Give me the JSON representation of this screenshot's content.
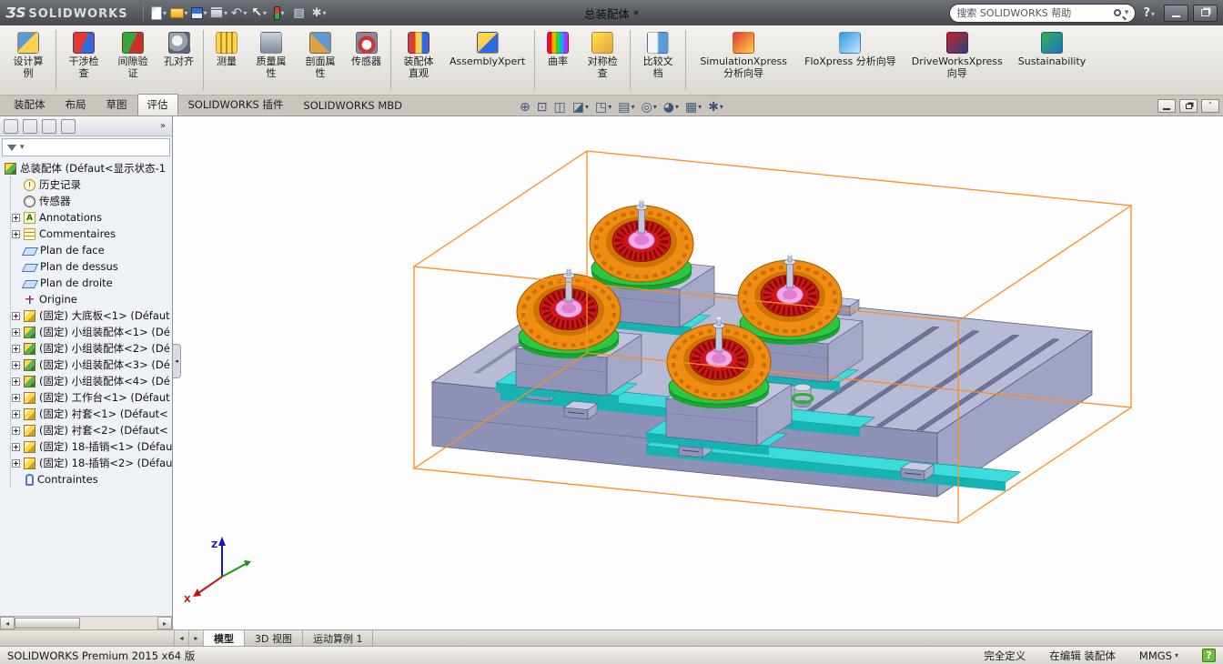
{
  "titlebar": {
    "logo_mark": "ƷS",
    "logo_text": "SOLIDWORKS",
    "doc_title": "总装配体 *",
    "search_placeholder": "搜索 SOLIDWORKS 帮助",
    "quick_icons": [
      {
        "name": "new-document-icon",
        "icon": "new-document",
        "dropdown": true
      },
      {
        "name": "open-icon",
        "icon": "open",
        "dropdown": true
      },
      {
        "name": "save-icon",
        "icon": "save",
        "dropdown": true
      },
      {
        "name": "print-icon",
        "icon": "print",
        "dropdown": true
      },
      {
        "name": "undo-icon",
        "icon": "undo",
        "dropdown": true
      },
      {
        "name": "select-icon",
        "icon": "select",
        "dropdown": true
      },
      {
        "name": "rebuild-icon",
        "icon": "rebuild",
        "dropdown": true
      },
      {
        "name": "file-properties-icon",
        "icon": "file-properties",
        "dropdown": false
      },
      {
        "name": "options-icon",
        "icon": "options",
        "dropdown": true
      }
    ]
  },
  "ribbon": {
    "items": [
      {
        "label": "设计算例",
        "icon": "design-study"
      },
      {
        "sep": true
      },
      {
        "label": "干涉检查",
        "icon": "interference-check"
      },
      {
        "label": "间隙验证",
        "icon": "clearance-verification"
      },
      {
        "label": "孔对齐",
        "icon": "hole-alignment"
      },
      {
        "sep": true
      },
      {
        "label": "测量",
        "icon": "measure"
      },
      {
        "label": "质量属性",
        "icon": "mass-properties"
      },
      {
        "label": "剖面属性",
        "icon": "section-properties"
      },
      {
        "label": "传感器",
        "icon": "sensor"
      },
      {
        "sep": true
      },
      {
        "label": "装配体直观",
        "icon": "assembly-visualization"
      },
      {
        "label": "AssemblyXpert",
        "icon": "assemblyxpert"
      },
      {
        "sep": true
      },
      {
        "label": "曲率",
        "icon": "curvature"
      },
      {
        "label": "对称检查",
        "icon": "symmetry-check"
      },
      {
        "sep": true
      },
      {
        "label": "比较文档",
        "icon": "compare-documents"
      },
      {
        "sep": true
      },
      {
        "label": "SimulationXpress 分析向导",
        "icon": "simulationxpress"
      },
      {
        "label": "FloXpress 分析向导",
        "icon": "floxpress"
      },
      {
        "label": "DriveWorksXpress 向导",
        "icon": "driveworksxpress"
      },
      {
        "label": "Sustainability",
        "icon": "sustainability"
      }
    ]
  },
  "command_tabs": [
    {
      "label": "装配体"
    },
    {
      "label": "布局"
    },
    {
      "label": "草图"
    },
    {
      "label": "评估",
      "active": true
    },
    {
      "label": "SOLIDWORKS 插件"
    },
    {
      "label": "SOLIDWORKS MBD"
    }
  ],
  "heads_up": [
    {
      "name": "zoom-fit-icon",
      "glyph": "⊕"
    },
    {
      "name": "zoom-area-icon",
      "glyph": "⊡"
    },
    {
      "name": "previous-view-icon",
      "glyph": "◫"
    },
    {
      "name": "section-view-icon",
      "glyph": "◪",
      "dropdown": true
    },
    {
      "name": "view-orientation-icon",
      "glyph": "◳",
      "dropdown": true
    },
    {
      "name": "display-style-icon",
      "glyph": "▤",
      "dropdown": true
    },
    {
      "name": "hide-show-icon",
      "glyph": "◎",
      "dropdown": true
    },
    {
      "name": "edit-appearance-icon",
      "glyph": "◕",
      "dropdown": true
    },
    {
      "name": "apply-scene-icon",
      "glyph": "▦",
      "dropdown": true
    },
    {
      "name": "view-settings-icon",
      "glyph": "✱",
      "dropdown": true
    }
  ],
  "manager_tabs": [
    {
      "name": "featuremanager-tab",
      "icon": "mt-feature"
    },
    {
      "name": "propertymanager-tab",
      "icon": "mt-property"
    },
    {
      "name": "configurationmanager-tab",
      "icon": "mt-config"
    },
    {
      "name": "displaymanager-tab",
      "icon": "mt-display"
    }
  ],
  "tree": {
    "more_glyph": "»",
    "root": "总装配体 (Défaut<显示状态-1",
    "items": [
      {
        "label": "历史记录",
        "icon": "history"
      },
      {
        "label": "传感器",
        "icon": "sensors"
      },
      {
        "label": "Annotations",
        "icon": "annotations",
        "expand": true
      },
      {
        "label": "Commentaires",
        "icon": "comments",
        "expand": true
      },
      {
        "label": "Plan de face",
        "icon": "plane"
      },
      {
        "label": "Plan de dessus",
        "icon": "plane"
      },
      {
        "label": "Plan de droite",
        "icon": "plane"
      },
      {
        "label": "Origine",
        "icon": "origin"
      },
      {
        "label": "(固定) 大底板<1> (Défaut",
        "icon": "part",
        "expand": true
      },
      {
        "label": "(固定) 小组装配体<1> (Dé",
        "icon": "subassembly",
        "expand": true
      },
      {
        "label": "(固定) 小组装配体<2> (Dé",
        "icon": "subassembly",
        "expand": true
      },
      {
        "label": "(固定) 小组装配体<3> (Dé",
        "icon": "subassembly",
        "expand": true
      },
      {
        "label": "(固定) 小组装配体<4> (Dé",
        "icon": "subassembly",
        "expand": true
      },
      {
        "label": "(固定) 工作台<1> (Défaut",
        "icon": "part",
        "expand": true
      },
      {
        "label": "(固定) 衬套<1> (Défaut<",
        "icon": "part",
        "expand": true
      },
      {
        "label": "(固定) 衬套<2> (Défaut<",
        "icon": "part",
        "expand": true
      },
      {
        "label": "(固定) 18-插销<1> (Défau",
        "icon": "part",
        "expand": true
      },
      {
        "label": "(固定) 18-插销<2> (Défau",
        "icon": "part",
        "expand": true
      },
      {
        "label": "Contraintes",
        "icon": "mates"
      }
    ]
  },
  "viewport": {
    "triad": {
      "x": "X",
      "z": "Z"
    },
    "colors": {
      "box": "#ff8d1f",
      "plate_top": "#b7bbd6",
      "plate_front": "#8e92b6",
      "plate_right": "#a0a4c4",
      "block_top": "#bfc3dd",
      "block_front": "#8f93b7",
      "block_right": "#a4a8c6",
      "rail": "#3ddbdb",
      "rail_dark": "#17b3b3",
      "green": "#29c840",
      "green_dark": "#1da332",
      "torus": "#ef8d12",
      "torus_dark": "#cf7300",
      "red": "#d11616",
      "pink": "#f3a9ea",
      "pink_dark": "#de7fd0"
    }
  },
  "bottom_tabs": [
    {
      "label": "模型",
      "active": true
    },
    {
      "label": "3D 视图"
    },
    {
      "label": "运动算例 1"
    }
  ],
  "statusbar": {
    "product": "SOLIDWORKS Premium 2015 x64 版",
    "defined": "完全定义",
    "editing": "在编辑 装配体",
    "units": "MMGS",
    "help": "?"
  }
}
